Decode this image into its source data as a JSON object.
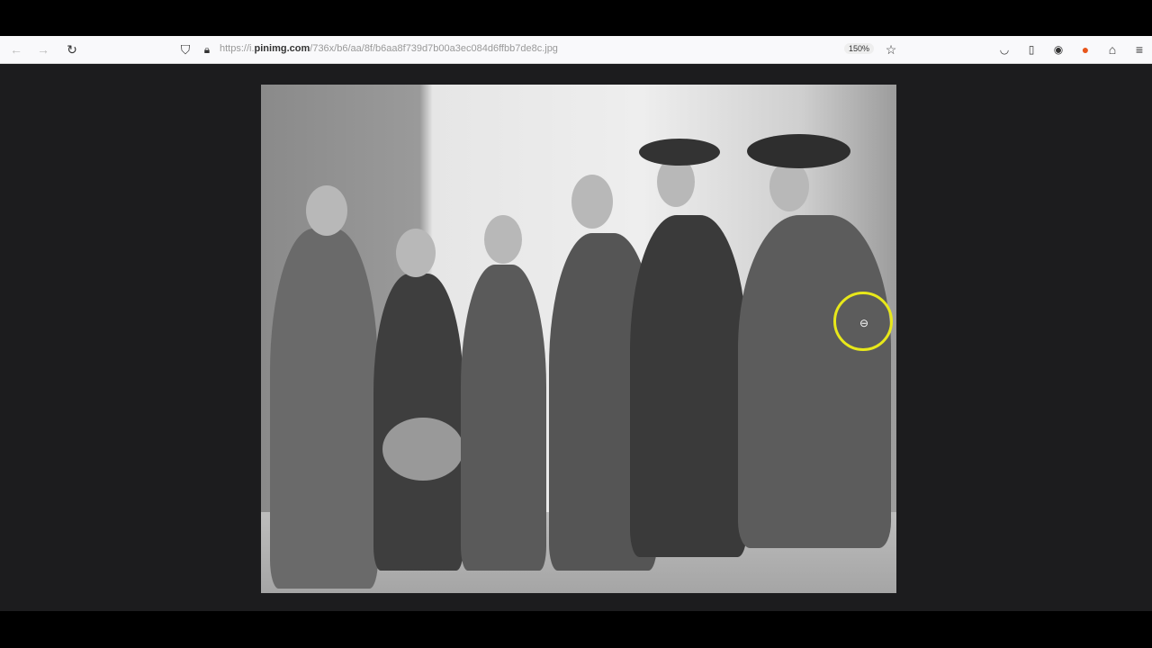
{
  "browser": {
    "url_prefix": "https://i.",
    "url_domain": "pinimg.com",
    "url_path": "/736x/b6/aa/8f/b6aa8f739d7b00a3ec084d6ffbb7de8c.jpg",
    "zoom_level": "150%"
  },
  "icons": {
    "back": "arrow-left-icon",
    "forward": "arrow-right-icon",
    "reload": "reload-icon",
    "shield": "tracking-shield-icon",
    "lock": "lock-icon",
    "star": "bookmark-star-icon",
    "pocket": "pocket-icon",
    "sidebar": "sidebar-icon",
    "account": "account-icon",
    "extension": "extension-icon",
    "extensions": "puzzle-icon",
    "menu": "hamburger-menu-icon",
    "cursor": "zoom-cursor-icon"
  },
  "colors": {
    "cursor_ring": "#e8e81a",
    "viewer_bg": "#1c1c1e"
  }
}
